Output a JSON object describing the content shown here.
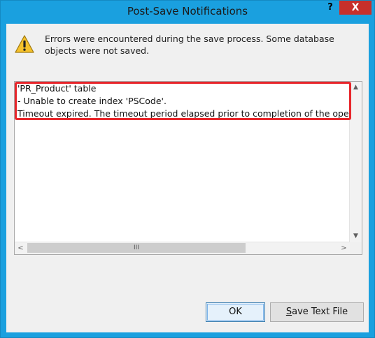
{
  "window": {
    "title": "Post-Save Notifications",
    "help_label": "?",
    "close_label": "X"
  },
  "message": "Errors were encountered during the save process. Some database objects were not saved.",
  "icon": "warning-icon",
  "details": {
    "lines": [
      "'PR_Product' table",
      "- Unable to create index 'PSCode'.",
      "Timeout expired.  The timeout period elapsed prior to completion of the operation or the server is not responding."
    ]
  },
  "scrollbars": {
    "up_arrow": "▲",
    "down_arrow": "▼",
    "left_arrow": "<",
    "right_arrow": ">",
    "grip": "III"
  },
  "buttons": {
    "ok_label": "OK",
    "save_text_first": "S",
    "save_text_rest": "ave Text File"
  },
  "colors": {
    "title_bar": "#1aa0df",
    "close_button": "#c7302b",
    "highlight_box": "#e8262b",
    "warning_fill": "#f6c22b"
  }
}
